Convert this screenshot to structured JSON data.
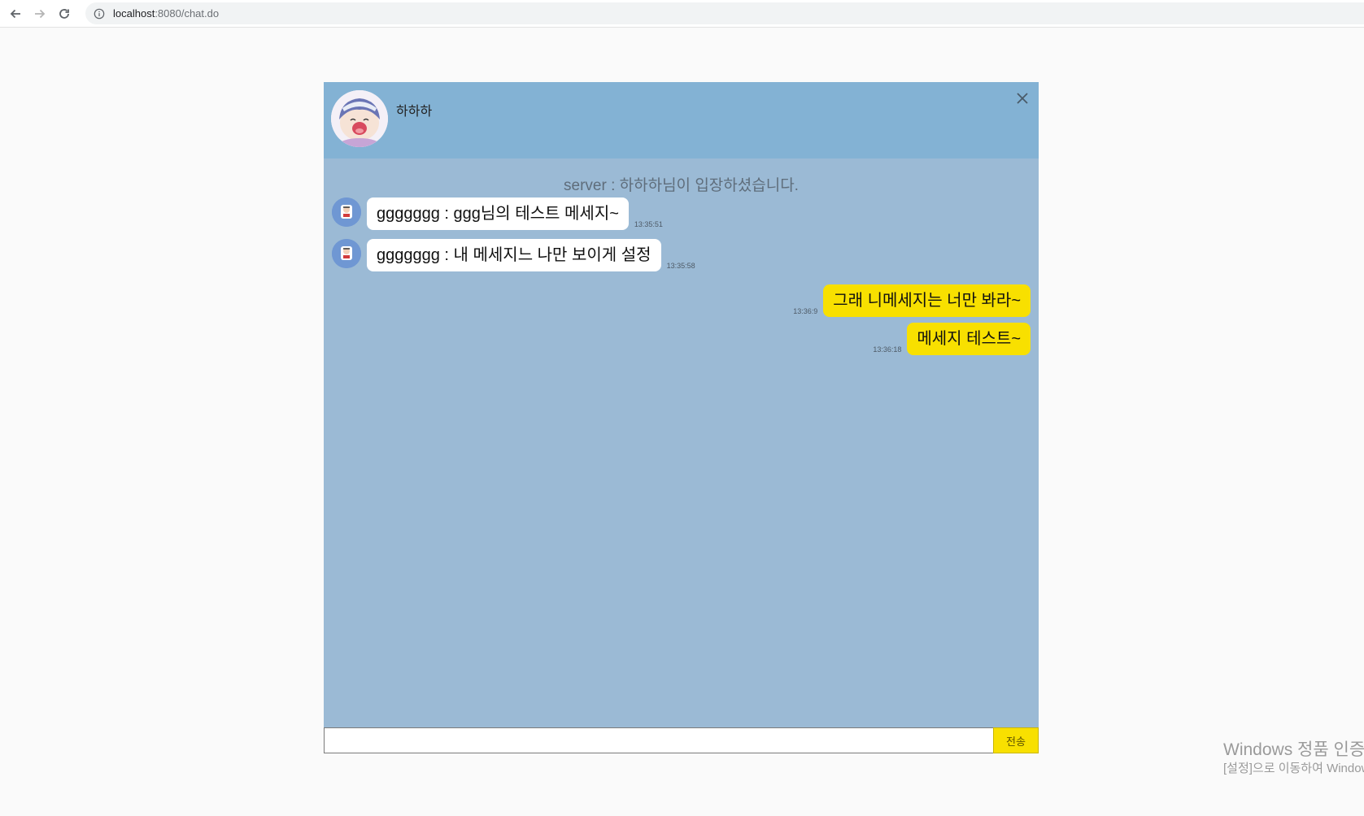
{
  "browser": {
    "url_host": "localhost",
    "url_rest": ":8080/chat.do"
  },
  "chat": {
    "room_name": "하하하",
    "server_message": "server : 하하하님이 입장하셨습니다.",
    "messages": [
      {
        "side": "other",
        "text": "ggggggg : ggg님의 테스트 메세지~",
        "time": "13:35:51"
      },
      {
        "side": "other",
        "text": "ggggggg : 내 메세지느 나만 보이게 설정",
        "time": "13:35:58"
      },
      {
        "side": "mine",
        "text": "그래 니메세지는 너만 봐라~",
        "time": "13:36:9"
      },
      {
        "side": "mine",
        "text": "메세지 테스트~",
        "time": "13:36:18"
      }
    ],
    "input_value": "",
    "send_label": "전송"
  },
  "watermark": {
    "line1": "Windows 정품 인증",
    "line2": "[설정]으로 이동하여 Windows"
  },
  "colors": {
    "header_bg": "#83b2d4",
    "body_bg": "#9bbad5",
    "mine_bubble": "#f8e000",
    "other_bubble": "#ffffff"
  },
  "icons": {
    "back": "arrow-left-icon",
    "forward": "arrow-right-icon",
    "reload": "reload-icon",
    "site_info": "info-icon",
    "close": "close-icon"
  }
}
